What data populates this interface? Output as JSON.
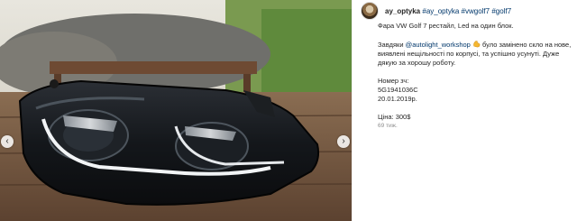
{
  "post": {
    "username": "ay_optyka",
    "header_hashtags": [
      "#ay_optyka",
      "#vwgolf7",
      "#golf7"
    ],
    "caption": {
      "line1": "Фара VW Golf 7 рестайл, Led на один блок.",
      "thanks_prefix": "Завдяки ",
      "mention": "@autolight_workshop",
      "thanks_rest": " було замінено скло на нове, виявлені нещільності по корпусі, та успішно усунуті. Дуже дякую за хорошу роботу.",
      "number_label": "Номер зч:",
      "part_number": "5G1941036C",
      "date": "20.01.2019р.",
      "price": "Ціна: 300$"
    },
    "timestamp": "69 тиж."
  },
  "icons": {
    "muscle": "flexed-biceps-icon",
    "prev": "chevron-left-icon",
    "next": "chevron-right-icon"
  },
  "carousel": {
    "prev_glyph": "‹",
    "next_glyph": "›"
  },
  "colors": {
    "link": "#00376b",
    "text": "#262626",
    "muted": "#8e8e8e"
  }
}
